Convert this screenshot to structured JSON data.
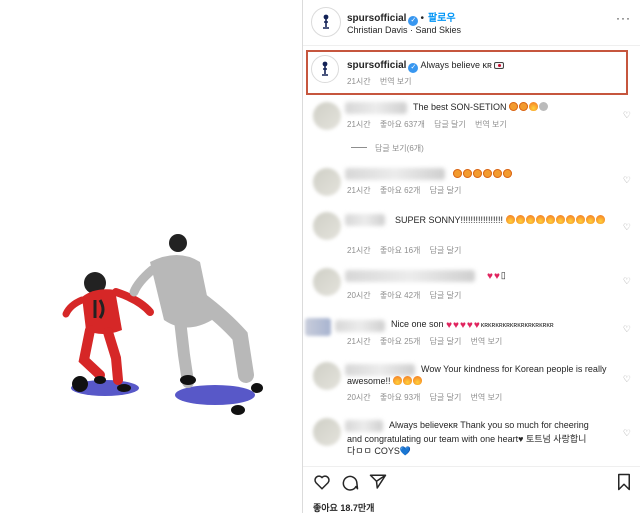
{
  "post": {
    "account": "spursofficial",
    "follow_label": "팔로우",
    "song": "Christian Davis · Sand Skies",
    "more": "···"
  },
  "caption": {
    "account": "spursofficial",
    "text": "Always believe ᴋʀ",
    "time": "21시간",
    "translate": "번역 보기"
  },
  "comments": [
    {
      "text": "The best SON-SETION",
      "emoji": [
        "face",
        "face",
        "fire",
        "other"
      ],
      "time": "21시간",
      "likes": "좋아요 637개",
      "reply": "답글 달기",
      "translate": "번역 보기"
    },
    {
      "text": "",
      "emoji": [
        "face",
        "face",
        "face",
        "face",
        "face",
        "face"
      ],
      "time": "21시간",
      "likes": "좋아요 62개",
      "reply": "답글 달기"
    },
    {
      "text": "SUPER SONNY!!!!!!!!!!!!!!!!!",
      "emoji": [
        "fire",
        "fire",
        "fire",
        "fire",
        "fire",
        "fire",
        "fire",
        "fire",
        "fire",
        "fire"
      ],
      "time": "21시간",
      "likes": "좋아요 16개",
      "reply": "답글 달기"
    },
    {
      "text": "",
      "emoji": [
        "heart",
        "heart"
      ],
      "time": "20시간",
      "likes": "좋아요 42개",
      "reply": "답글 달기"
    },
    {
      "text": "Nice one son",
      "emoji": [
        "heart",
        "heart",
        "heart",
        "heart",
        "heart"
      ],
      "suffix": "ᴋʀᴋʀᴋʀᴋʀᴋʀᴋʀᴋʀᴋʀᴋʀᴋʀ",
      "time": "21시간",
      "likes": "좋아요 25개",
      "reply": "답글 달기",
      "translate": "번역 보기"
    },
    {
      "line1": "Wow Your kindness for Korean people is really",
      "line2": "awesome!!",
      "emoji": [
        "fire",
        "fire",
        "fire"
      ],
      "time": "20시간",
      "likes": "좋아요 93개",
      "reply": "답글 달기",
      "translate": "번역 보기"
    },
    {
      "line1": "Always believeᴋʀ  Thank you so much for cheering",
      "line2": "and congratulating our team with one heart♥ 토트넘 사랑합니",
      "line3": "다ㅁㅁ COYS💙"
    }
  ],
  "view_replies": "답글 보기(6개)",
  "likes_total": "좋아요 18.7만개",
  "colors": {
    "highlight": "#c6563e",
    "verified": "#3897f0",
    "follow": "#0095f6",
    "heart": "#e0245e"
  }
}
